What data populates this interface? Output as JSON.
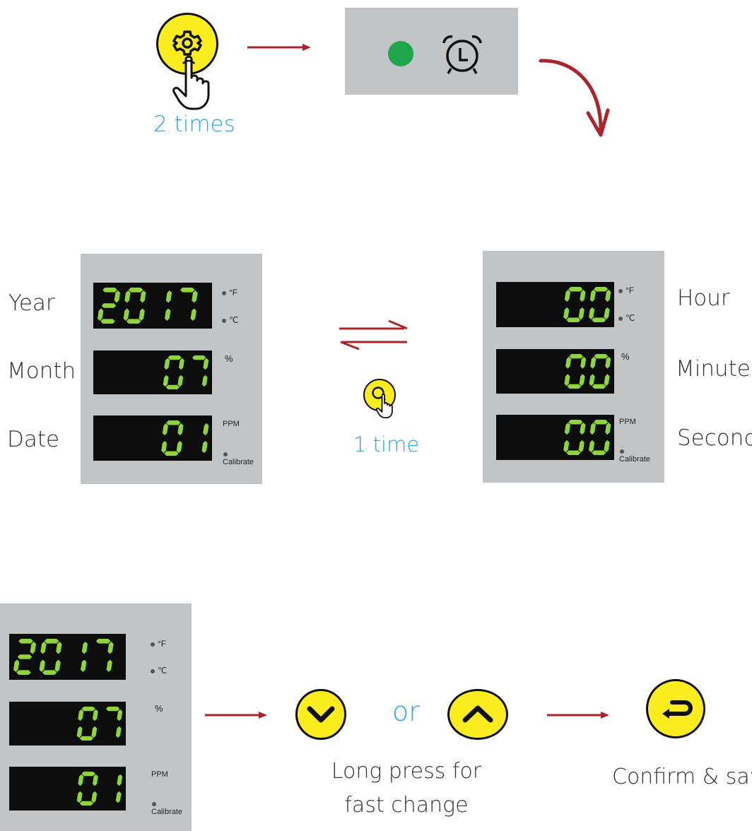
{
  "step1": {
    "settings_count_label": "2 times",
    "status_led_color": "#1fa64a",
    "icons": [
      "settings-gear-icon",
      "hand-pointer-icon",
      "alarm-clock-icon"
    ]
  },
  "date_panel": {
    "row_labels": [
      "Year",
      "Month",
      "Date"
    ],
    "year_value": "2017",
    "month_value": "07",
    "date_value": "01"
  },
  "time_panel": {
    "row_labels": [
      "Hour",
      "Minute",
      "Second"
    ],
    "hour_value": "00",
    "minute_value": "00",
    "second_value": "00"
  },
  "indicators": {
    "fahrenheit": "°F",
    "celsius": "℃",
    "percent": "%",
    "ppm": "PPM",
    "calibrate": "Calibrate"
  },
  "toggle": {
    "count_label": "1 time",
    "icon": "magnifier-icon"
  },
  "adjust": {
    "or_label": "or",
    "hint_line1": "Long press for",
    "hint_line2": "fast change",
    "down_icon": "chevron-down-icon",
    "up_icon": "chevron-up-icon"
  },
  "confirm": {
    "label": "Confirm & save",
    "icon": "enter-return-icon"
  },
  "colors": {
    "arrow": "#a8252b",
    "button_yellow": "#fbec1f",
    "segment_green": "#8ed43a",
    "label_blue": "#2aa6e0",
    "panel_gray": "#c3c4c6"
  }
}
